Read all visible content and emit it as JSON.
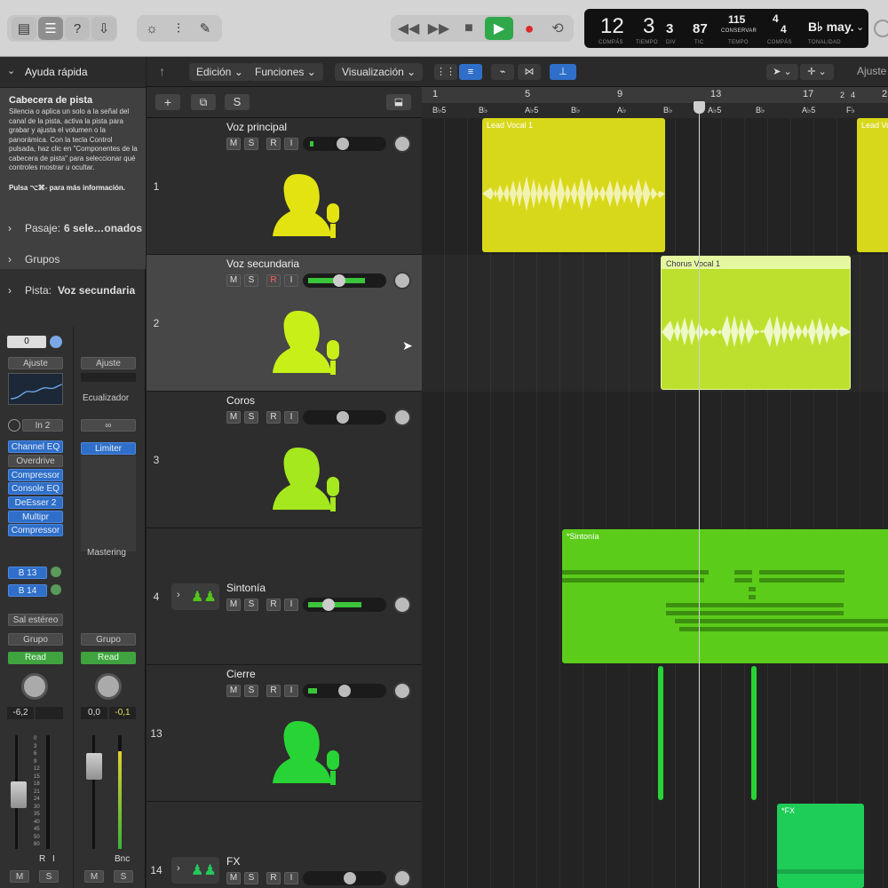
{
  "toolbar": {
    "left_icons": [
      "library-icon",
      "inspector-icon",
      "help-icon",
      "download-icon"
    ],
    "mid_icons": [
      "brightness-icon",
      "mixer-icon",
      "pencil-icon"
    ],
    "transport": [
      "rewind-icon",
      "forward-icon",
      "stop-icon",
      "play-icon",
      "record-icon",
      "cycle-icon"
    ]
  },
  "lcd": {
    "bar": "12",
    "beat": "3",
    "div": "3",
    "tick": "87",
    "bar_label": "COMPÁS",
    "beat_label": "TIEMPO",
    "div_label": "DIV",
    "tick_label": "TIC",
    "tempo": "115",
    "tempo_mode": "CONSERVAR",
    "tempo_label": "TEMPO",
    "sig_num": "4",
    "sig_den": "4",
    "sig_label": "COMPÁS",
    "key": "B♭ may.",
    "key_label": "TONALIDAD"
  },
  "inspector": {
    "title": "Ayuda rápida",
    "help_title": "Cabecera de pista",
    "help_text": "Silencia o aplica un solo a la señal del canal de la pista, activa la pista para grabar y ajusta el volumen o la panorámica. Con la tecla Control pulsada, haz clic en \"Componentes de la cabecera de pista\" para seleccionar qué controles mostrar u ocultar.",
    "help_more": "Pulsa ⌥⌘- para más información.",
    "rows": [
      {
        "label": "Pasaje:",
        "value": "6 sele…onados"
      },
      {
        "label": "Grupos",
        "value": ""
      },
      {
        "label": "Pista:",
        "value": "Voz secundaria"
      }
    ],
    "strip1": {
      "value": "0",
      "settings": "Ajuste",
      "input": "In 2",
      "plugins": [
        "Channel EQ",
        "Overdrive",
        "Compressor",
        "Console EQ",
        "DeEsser 2",
        "Multipr",
        "Compressor"
      ],
      "sends": [
        "B 13",
        "B 14"
      ],
      "output": "Sal estéreo",
      "group": "Grupo",
      "automation": "Read",
      "volume": "-6,2",
      "mute": "M",
      "solo": "S",
      "rec": "R",
      "input_mon": "I"
    },
    "strip2": {
      "settings": "Ajuste",
      "eq": "Ecualizador",
      "plugins": [
        "Limiter"
      ],
      "name": "Mastering",
      "group": "Grupo",
      "automation": "Read",
      "volume": "0,0",
      "peak": "-0,1",
      "bounce": "Bnc",
      "mute": "M",
      "solo": "S"
    },
    "meter_scale": [
      "0",
      "3",
      "6",
      "9",
      "12",
      "15",
      "18",
      "21",
      "24",
      "30",
      "35",
      "40",
      "45",
      "50",
      "60"
    ]
  },
  "menubar": {
    "edit": "Edición",
    "functions": "Funciones",
    "view": "Visualización",
    "settings_label": "Ajuste"
  },
  "header_buttons": {
    "add": "+",
    "dup": "⧉",
    "solo": "S"
  },
  "tracks": [
    {
      "num": "1",
      "name": "Voz principal",
      "color": "#e3e311",
      "rec_armed": false
    },
    {
      "num": "2",
      "name": "Voz secundaria",
      "color": "#c8f018",
      "rec_armed": true
    },
    {
      "num": "3",
      "name": "Coros",
      "color": "#a5e81e",
      "rec_armed": false
    },
    {
      "num": "4",
      "name": "Sintonía",
      "color": "#52c41a",
      "rec_armed": false
    },
    {
      "num": "13",
      "name": "Cierre",
      "color": "#28d435",
      "rec_armed": false
    },
    {
      "num": "14",
      "name": "FX",
      "color": "#25c85a",
      "rec_armed": false
    }
  ],
  "track_buttons": {
    "m": "M",
    "s": "S",
    "r": "R",
    "i": "I"
  },
  "ruler": {
    "bars": [
      "1",
      "5",
      "9",
      "13",
      "17",
      "2",
      "4",
      "2"
    ],
    "chords": [
      "B♭5",
      "B♭",
      "A♭5",
      "B♭",
      "A♭",
      "B♭",
      "A♭5",
      "B♭",
      "A♭5",
      "F♭"
    ]
  },
  "regions": [
    {
      "name": "Lead Vocal 1",
      "color": "#d8d81a"
    },
    {
      "name": "Chorus Vocal 1",
      "color": "#bde02e"
    },
    {
      "name": "*Sintonía",
      "color": "#5ccc1a"
    },
    {
      "name": "*FX",
      "color": "#1dcd57"
    }
  ]
}
